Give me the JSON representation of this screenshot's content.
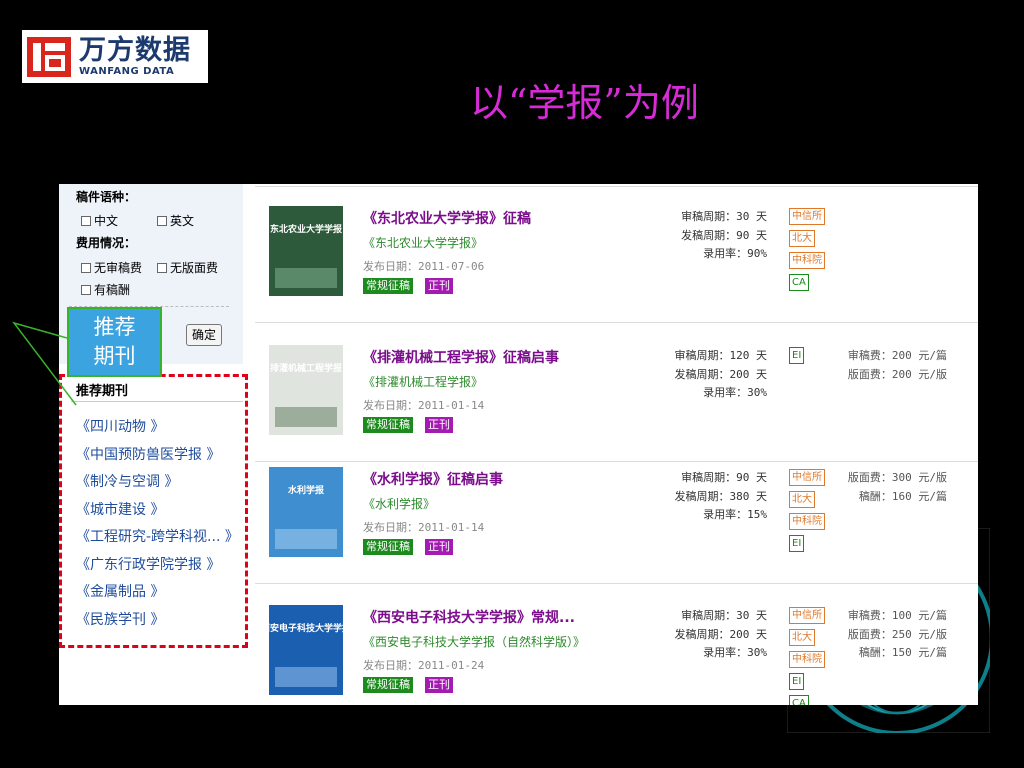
{
  "logo": {
    "cn": "万方数据",
    "en": "WANFANG DATA"
  },
  "slide_title": "以“学报”为例",
  "callout": {
    "line1": "推荐",
    "line2": "期刊"
  },
  "filter": {
    "lang_label": "稿件语种：",
    "lang_options": [
      "中文",
      "英文"
    ],
    "fee_label": "费用情况：",
    "fee_options": [
      "无审稿费",
      "无版面费",
      "有稿酬"
    ],
    "confirm_label": "确定"
  },
  "recommended": {
    "title": "推荐期刊",
    "items": [
      "《四川动物 》",
      "《中国预防兽医学报 》",
      "《制冷与空调 》",
      "《城市建设 》",
      "《工程研究-跨学科视... 》",
      "《广东行政学院学报 》",
      "《金属制品 》",
      "《民族学刊 》"
    ]
  },
  "journals": [
    {
      "title": "《东北农业大学学报》征稿",
      "subtitle": "《东北农业大学学报》",
      "date": "发布日期：2011-07-06",
      "tags": [
        "常规征稿",
        "正刊"
      ],
      "stats": [
        "审稿周期：30 天",
        "发稿周期：90 天",
        "录用率：90%"
      ],
      "badges": [
        "中信所",
        "北大",
        "中科院",
        "CA"
      ],
      "fees": [],
      "cover_title": "东北农业大学学报",
      "cover_colors": {
        "bg": "#2c5a3a",
        "accent": "#7aa98a"
      }
    },
    {
      "title": "《排灌机械工程学报》征稿启事",
      "subtitle": "《排灌机械工程学报》",
      "date": "发布日期：2011-01-14",
      "tags": [
        "常规征稿",
        "正刊"
      ],
      "stats": [
        "审稿周期：120 天",
        "发稿周期：200 天",
        "录用率：30%"
      ],
      "badges": [
        "EI"
      ],
      "fees": [
        "审稿费：200 元/篇",
        "版面费：200 元/版"
      ],
      "cover_title": "排灌机械工程学报",
      "cover_colors": {
        "bg": "#dfe4de",
        "accent": "#6f8a6e"
      }
    },
    {
      "title": "《水利学报》征稿启事",
      "subtitle": "《水利学报》",
      "date": "发布日期：2011-01-14",
      "tags": [
        "常规征稿",
        "正刊"
      ],
      "stats": [
        "审稿周期：90 天",
        "发稿周期：380 天",
        "录用率：15%"
      ],
      "badges": [
        "中信所",
        "北大",
        "中科院",
        "EI"
      ],
      "fees": [
        "版面费：300 元/版",
        "稿酬：160 元/篇"
      ],
      "cover_title": "水利学报",
      "cover_colors": {
        "bg": "#3f8fd0",
        "accent": "#9cc8ee"
      }
    },
    {
      "title": "《西安电子科技大学学报》常规...",
      "subtitle": "《西安电子科技大学学报（自然科学版）》",
      "date": "发布日期：2011-01-24",
      "tags": [
        "常规征稿",
        "正刊"
      ],
      "stats": [
        "审稿周期：30 天",
        "发稿周期：200 天",
        "录用率：30%"
      ],
      "badges": [
        "中信所",
        "北大",
        "中科院",
        "EI",
        "CA"
      ],
      "fees": [
        "审稿费：100 元/篇",
        "版面费：250 元/版",
        "稿酬：150 元/篇"
      ],
      "cover_title": "西安电子科技大学学报",
      "cover_colors": {
        "bg": "#1a5fb0",
        "accent": "#8ab8e8"
      }
    }
  ]
}
